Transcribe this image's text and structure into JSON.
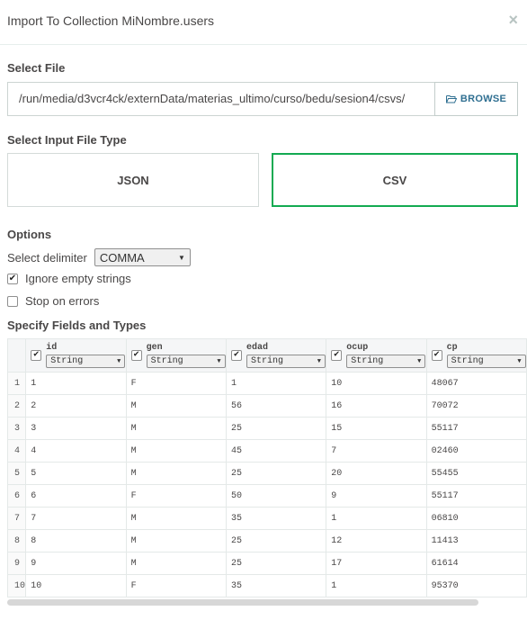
{
  "header": {
    "title": "Import To Collection MiNombre.users",
    "close": "×"
  },
  "select_file": {
    "label": "Select File",
    "path": "/run/media/d3vcr4ck/externData/materias_ultimo/curso/bedu/sesion4/csvs/",
    "browse_label": "BROWSE"
  },
  "file_type": {
    "label": "Select Input File Type",
    "json_label": "JSON",
    "csv_label": "CSV",
    "selected": "CSV"
  },
  "options": {
    "label": "Options",
    "delimiter_label": "Select delimiter",
    "delimiter_value": "COMMA",
    "ignore_empty_label": "Ignore empty strings",
    "ignore_empty_checked": true,
    "stop_on_errors_label": "Stop on errors",
    "stop_on_errors_checked": false
  },
  "fields": {
    "label": "Specify Fields and Types",
    "columns": [
      {
        "name": "id",
        "type": "String",
        "checked": true
      },
      {
        "name": "gen",
        "type": "String",
        "checked": true
      },
      {
        "name": "edad",
        "type": "String",
        "checked": true
      },
      {
        "name": "ocup",
        "type": "String",
        "checked": true
      },
      {
        "name": "cp",
        "type": "String",
        "checked": true
      }
    ],
    "rows": [
      {
        "n": "1",
        "cells": [
          "1",
          "F",
          "1",
          "10",
          "48067"
        ]
      },
      {
        "n": "2",
        "cells": [
          "2",
          "M",
          "56",
          "16",
          "70072"
        ]
      },
      {
        "n": "3",
        "cells": [
          "3",
          "M",
          "25",
          "15",
          "55117"
        ]
      },
      {
        "n": "4",
        "cells": [
          "4",
          "M",
          "45",
          "7",
          "02460"
        ]
      },
      {
        "n": "5",
        "cells": [
          "5",
          "M",
          "25",
          "20",
          "55455"
        ]
      },
      {
        "n": "6",
        "cells": [
          "6",
          "F",
          "50",
          "9",
          "55117"
        ]
      },
      {
        "n": "7",
        "cells": [
          "7",
          "M",
          "35",
          "1",
          "06810"
        ]
      },
      {
        "n": "8",
        "cells": [
          "8",
          "M",
          "25",
          "12",
          "11413"
        ]
      },
      {
        "n": "9",
        "cells": [
          "9",
          "M",
          "25",
          "17",
          "61614"
        ]
      },
      {
        "n": "10",
        "cells": [
          "10",
          "F",
          "35",
          "1",
          "95370"
        ]
      }
    ]
  },
  "colors": {
    "accent_green": "#13aa52",
    "browse_blue": "#2f6f91"
  },
  "icons": {
    "browse": "folder-open-icon",
    "close": "close-icon",
    "checkbox": "checkmark-icon"
  }
}
